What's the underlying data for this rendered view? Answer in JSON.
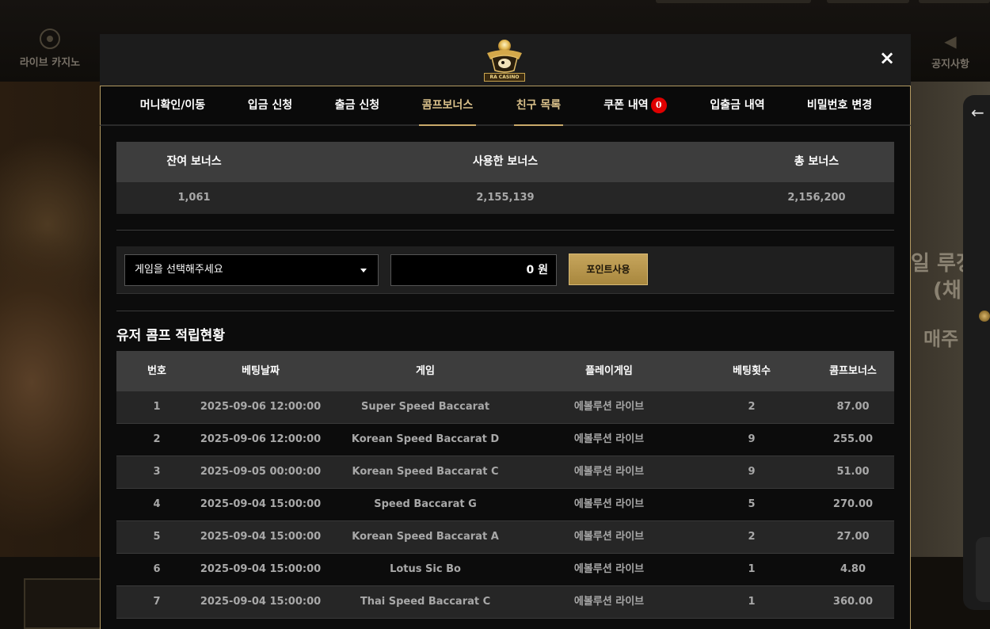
{
  "background": {
    "nav_left_label": "라이브 카지노",
    "nav_right_label": "공지사항",
    "hero_text_lines": [
      "일 루징",
      "(채",
      "매주"
    ]
  },
  "modal": {
    "logo_text": "RA CASINO",
    "close_icon": "×",
    "tabs": [
      {
        "label": "머니확인/이동",
        "active": false
      },
      {
        "label": "입금 신청",
        "active": false
      },
      {
        "label": "출금 신청",
        "active": false
      },
      {
        "label": "콤프보너스",
        "active": true
      },
      {
        "label": "친구 목록",
        "active": true
      },
      {
        "label": "쿠폰 내역",
        "active": false,
        "badge": "0"
      },
      {
        "label": "입출금 내역",
        "active": false
      },
      {
        "label": "비밀번호 변경",
        "active": false
      }
    ],
    "summary": {
      "headers": [
        "잔여 보너스",
        "사용한 보너스",
        "총 보너스"
      ],
      "values": [
        "1,061",
        "2,155,139",
        "2,156,200"
      ]
    },
    "point_use": {
      "select_value": "게임을 선택해주세요",
      "amount_value": "0 원",
      "button_label": "포인트사용"
    },
    "history_title": "유저 콤프 적립현황",
    "history": {
      "headers": [
        "번호",
        "베팅날짜",
        "게임",
        "플레이게임",
        "베팅횟수",
        "콤프보너스"
      ],
      "rows": [
        [
          "1",
          "2025-09-06 12:00:00",
          "Super Speed Baccarat",
          "에볼루션 라이브",
          "2",
          "87.00"
        ],
        [
          "2",
          "2025-09-06 12:00:00",
          "Korean Speed Baccarat D",
          "에볼루션 라이브",
          "9",
          "255.00"
        ],
        [
          "3",
          "2025-09-05 00:00:00",
          "Korean Speed Baccarat C",
          "에볼루션 라이브",
          "9",
          "51.00"
        ],
        [
          "4",
          "2025-09-04 15:00:00",
          "Speed Baccarat G",
          "에볼루션 라이브",
          "5",
          "270.00"
        ],
        [
          "5",
          "2025-09-04 15:00:00",
          "Korean Speed Baccarat A",
          "에볼루션 라이브",
          "2",
          "27.00"
        ],
        [
          "6",
          "2025-09-04 15:00:00",
          "Lotus Sic Bo",
          "에볼루션 라이브",
          "1",
          "4.80"
        ],
        [
          "7",
          "2025-09-04 15:00:00",
          "Thai Speed Baccarat C",
          "에볼루션 라이브",
          "1",
          "360.00"
        ]
      ]
    }
  },
  "colors": {
    "accent_gold": "#c9a96a",
    "badge_red": "#e00000",
    "button_gold": "#b8964c"
  }
}
